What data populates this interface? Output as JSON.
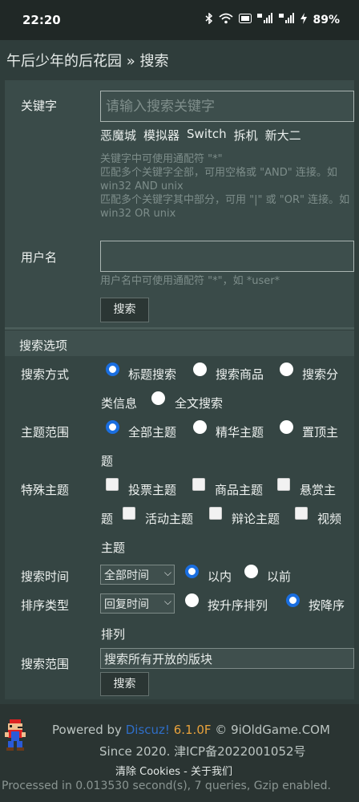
{
  "status_bar": {
    "time": "22:20",
    "battery": "89%",
    "icons": [
      "bluetooth-icon",
      "wifi-icon",
      "hd-icon",
      "signal-5g-icon",
      "signal-5g-icon",
      "charging-icon"
    ]
  },
  "breadcrumb": {
    "site": "午后少年的后花园",
    "sep": "»",
    "current": "搜索"
  },
  "keyword": {
    "label": "关键字",
    "placeholder": "请输入搜索关键字",
    "hot": [
      "恶魔城",
      "模拟器",
      "Switch",
      "拆机",
      "新大二"
    ],
    "help": [
      "关键字中可使用通配符 \"*\"",
      "匹配多个关键字全部，可用空格或 \"AND\" 连接。如 win32 AND unix",
      "匹配多个关键字其中部分，可用 \"|\" 或 \"OR\" 连接。如 win32 OR unix"
    ]
  },
  "username": {
    "label": "用户名",
    "value": "",
    "help": "用户名中可使用通配符 \"*\"，如 *user*"
  },
  "search_button": "搜索",
  "options_header": "搜索选项",
  "search_mode": {
    "label": "搜索方式",
    "options": [
      "标题搜索",
      "搜索商品",
      "搜索分",
      "类信息",
      "全文搜索"
    ],
    "selected": "标题搜索"
  },
  "topic_scope": {
    "label": "主题范围",
    "options": [
      "全部主题",
      "精华主题",
      "置顶主",
      "题"
    ],
    "selected": "全部主题"
  },
  "special": {
    "label": "特殊主题",
    "options": [
      "投票主题",
      "商品主题",
      "悬赏主",
      "题",
      "活动主题",
      "辩论主题",
      "视频",
      "主题"
    ]
  },
  "search_time": {
    "label": "搜索时间",
    "select": "全部时间",
    "options": [
      "以内",
      "以前"
    ],
    "selected": "以内"
  },
  "sort": {
    "label": "排序类型",
    "select": "回复时间",
    "options": [
      "按升序排列",
      "按降序",
      "排列"
    ],
    "selected": "按降序"
  },
  "range": {
    "label": "搜索范围",
    "value": "搜索所有开放的版块"
  },
  "footer": {
    "powered": "Powered by",
    "brand": "Discuz!",
    "version": "6.1.0F",
    "copy": "©",
    "site": "9iOldGame.COM",
    "since": "Since 2020. 津ICP备2022001052号",
    "links": "清除 Cookies - 关于我们",
    "processed": "Processed in 0.013530 second(s), 7 queries, Gzip enabled."
  },
  "colors": {
    "accent": "#1a6ee0",
    "brand": "#2f6ec8",
    "version": "#e8a23c"
  }
}
